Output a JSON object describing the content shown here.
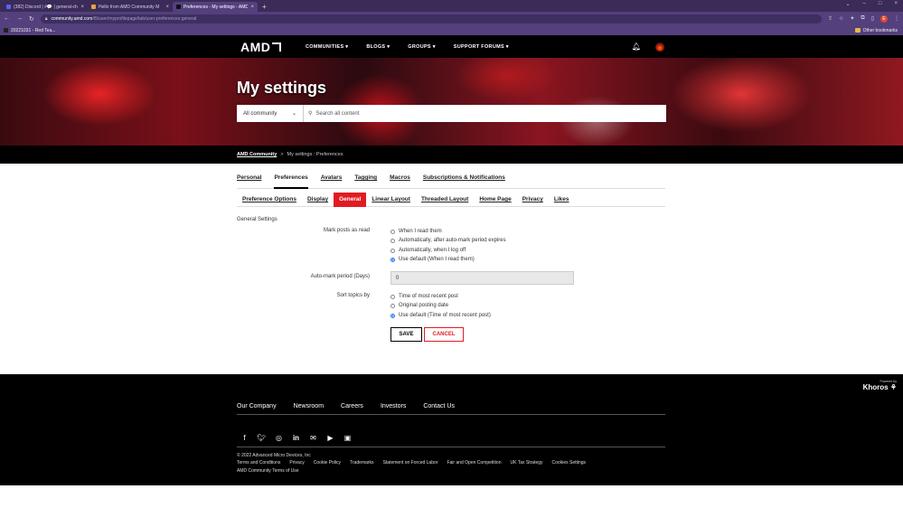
{
  "browser": {
    "tabs": [
      {
        "title": "(382) Discord | #💬 | general-ch",
        "color": "#5865f2"
      },
      {
        "title": "Hello from AMD Community M",
        "color": "#e8a33b"
      },
      {
        "title": "Preferences - My settings - AMD",
        "color": "#111111"
      }
    ],
    "new_tab": "+",
    "url_host": "community.amd.com",
    "url_path": "/t5/user/myprofilepage/tab/user-preferences:general",
    "bookmark": "20221031 - Red Tea...",
    "other_bookmarks": "Other bookmarks",
    "profile_initial": "E"
  },
  "nav": {
    "logo": "AMD",
    "items": [
      "COMMUNITIES ▾",
      "BLOGS ▾",
      "GROUPS ▾",
      "SUPPORT FORUMS ▾"
    ]
  },
  "hero": {
    "title": "My settings",
    "scope": "All community",
    "search_placeholder": "Search all content"
  },
  "breadcrumb": {
    "root": "AMD Community",
    "sep": ">",
    "current": "My settings : Preferences"
  },
  "main_tabs": [
    "Personal",
    "Preferences",
    "Avatars",
    "Tagging",
    "Macros",
    "Subscriptions & Notifications"
  ],
  "sub_tabs": [
    "Preference Options",
    "Display",
    "General",
    "Linear Layout",
    "Threaded Layout",
    "Home Page",
    "Privacy",
    "Likes"
  ],
  "form": {
    "section": "General Settings",
    "mark_label": "Mark posts as read",
    "mark_options": [
      "When I read them",
      "Automatically, after auto-mark period expires",
      "Automatically, when I log off",
      "Use default (When I read them)"
    ],
    "period_label": "Auto-mark period (Days)",
    "period_value": "0",
    "sort_label": "Sort topics by",
    "sort_options": [
      "Time of most recent post",
      "Original posting date",
      "Use default (Time of most recent post)"
    ],
    "save": "SAVE",
    "cancel": "CANCEL"
  },
  "footer": {
    "powered": "Powered by",
    "brand": "Khoros",
    "links": [
      "Our Company",
      "Newsroom",
      "Careers",
      "Investors",
      "Contact Us"
    ],
    "social_icons": [
      "facebook-icon",
      "twitter-icon",
      "instagram-icon",
      "linkedin-icon",
      "email-icon",
      "youtube-icon",
      "twitch-icon"
    ],
    "copyright": "© 2022 Advanced Micro Devices, Inc",
    "legal": [
      "Terms and Conditions",
      "Privacy",
      "Cookie Policy",
      "Trademarks",
      "Statement on Forced Labor",
      "Fair and Open Competition",
      "UK Tax Strategy",
      "Cookies Settings"
    ],
    "terms": "AMD Community Terms of Use"
  }
}
